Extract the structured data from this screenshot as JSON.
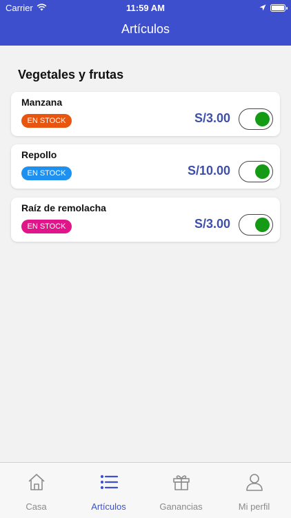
{
  "status_bar": {
    "carrier": "Carrier",
    "time": "11:59 AM"
  },
  "header": {
    "title": "Artículos"
  },
  "section": {
    "title": "Vegetales y frutas"
  },
  "items": [
    {
      "name": "Manzana",
      "badge": "EN STOCK",
      "badge_color": "#e8550f",
      "price": "S/3.00",
      "enabled": true
    },
    {
      "name": "Repollo",
      "badge": "EN STOCK",
      "badge_color": "#1e90ef",
      "price": "S/10.00",
      "enabled": true
    },
    {
      "name": "Raíz de remolacha",
      "badge": "EN STOCK",
      "badge_color": "#e0158a",
      "price": "S/3.00",
      "enabled": true
    }
  ],
  "tabs": [
    {
      "label": "Casa",
      "icon": "home-icon",
      "active": false
    },
    {
      "label": "Artículos",
      "icon": "list-icon",
      "active": true
    },
    {
      "label": "Ganancias",
      "icon": "gift-icon",
      "active": false
    },
    {
      "label": "Mi perfil",
      "icon": "user-icon",
      "active": false
    }
  ],
  "colors": {
    "primary": "#3d4fcc",
    "price": "#3d4fa8",
    "toggle_on": "#149a14"
  }
}
